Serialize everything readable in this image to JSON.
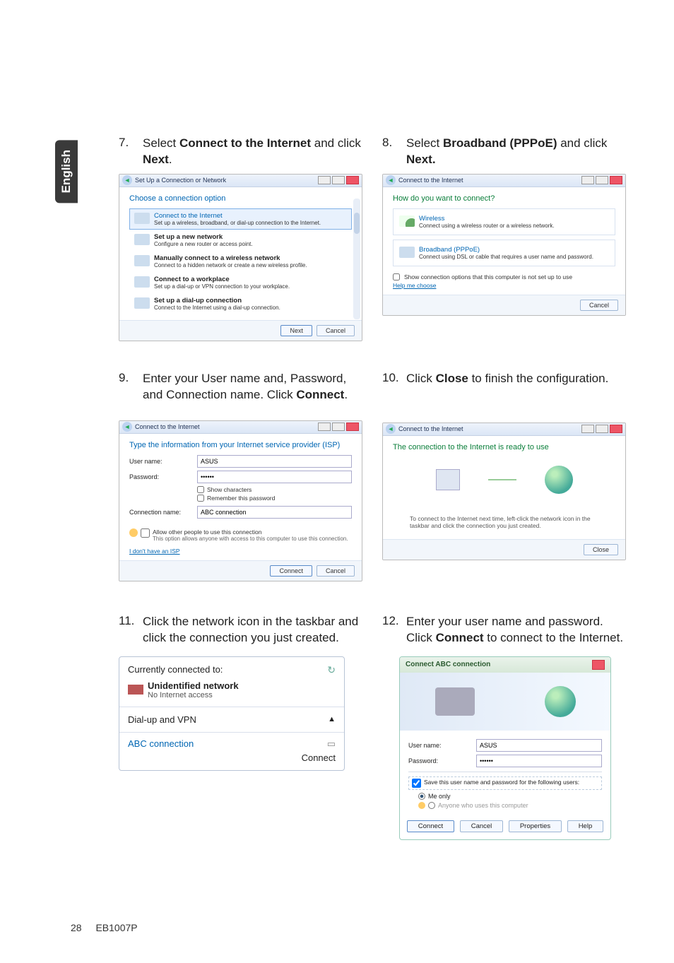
{
  "language_tab": "English",
  "steps": {
    "s7": {
      "num": "7.",
      "pre": "Select ",
      "bold": "Connect to the Internet",
      "mid": " and click ",
      "bold2": "Next",
      "post": "."
    },
    "s8": {
      "num": "8.",
      "pre": "Select ",
      "bold": "Broadband (PPPoE)",
      "mid": " and click ",
      "bold2": "Next.",
      "post": ""
    },
    "s9": {
      "num": "9.",
      "text": "Enter your User name and, Password, and Connection name. Click ",
      "bold": "Connect",
      "post": "."
    },
    "s10": {
      "num": "10.",
      "pre": "Click ",
      "bold": "Close",
      "post": " to finish the configuration."
    },
    "s11": {
      "num": "11.",
      "text": "Click the network icon in the taskbar and click the connection you just created."
    },
    "s12": {
      "num": "12.",
      "pre": "Enter your user name and password. Click ",
      "bold": "Connect",
      "post": " to connect to the Internet."
    }
  },
  "dlg7": {
    "title": "Set Up a Connection or Network",
    "heading": "Choose a connection option",
    "opts": [
      {
        "t": "Connect to the Internet",
        "d": "Set up a wireless, broadband, or dial-up connection to the Internet."
      },
      {
        "t": "Set up a new network",
        "d": "Configure a new router or access point."
      },
      {
        "t": "Manually connect to a wireless network",
        "d": "Connect to a hidden network or create a new wireless profile."
      },
      {
        "t": "Connect to a workplace",
        "d": "Set up a dial-up or VPN connection to your workplace."
      },
      {
        "t": "Set up a dial-up connection",
        "d": "Connect to the Internet using a dial-up connection."
      }
    ],
    "next": "Next",
    "cancel": "Cancel"
  },
  "dlg8": {
    "title": "Connect to the Internet",
    "heading": "How do you want to connect?",
    "opts": [
      {
        "t": "Wireless",
        "d": "Connect using a wireless router or a wireless network."
      },
      {
        "t": "Broadband (PPPoE)",
        "d": "Connect using DSL or cable that requires a user name and password."
      }
    ],
    "show_opts": "Show connection options that this computer is not set up to use",
    "help": "Help me choose",
    "cancel": "Cancel"
  },
  "dlg9": {
    "title": "Connect to the Internet",
    "heading": "Type the information from your Internet service provider (ISP)",
    "user_lbl": "User name:",
    "user_val": "ASUS",
    "pass_lbl": "Password:",
    "pass_val": "••••••",
    "show_chars": "Show characters",
    "remember": "Remember this password",
    "conn_lbl": "Connection name:",
    "conn_val": "ABC connection",
    "allow": "Allow other people to use this connection",
    "allow_d": "This option allows anyone with access to this computer to use this connection.",
    "noisp": "I don't have an ISP",
    "connect": "Connect",
    "cancel": "Cancel"
  },
  "dlg10": {
    "title": "Connect to the Internet",
    "heading": "The connection to the Internet is ready to use",
    "note": "To connect to the Internet next time, left-click the network icon in the taskbar and click the connection you just created.",
    "close": "Close"
  },
  "popup11": {
    "hdr": "Currently connected to:",
    "netname": "Unidentified network",
    "netsub": "No Internet access",
    "section": "Dial-up and VPN",
    "conn": "ABC connection",
    "connect": "Connect"
  },
  "dlg12": {
    "title": "Connect ABC connection",
    "user_lbl": "User name:",
    "user_val": "ASUS",
    "pass_lbl": "Password:",
    "pass_val": "••••••",
    "save": "Save this user name and password for the following users:",
    "me": "Me only",
    "anyone": "Anyone who uses this computer",
    "connect": "Connect",
    "cancel": "Cancel",
    "props": "Properties",
    "help": "Help"
  },
  "footer": {
    "page": "28",
    "model": "EB1007P"
  }
}
